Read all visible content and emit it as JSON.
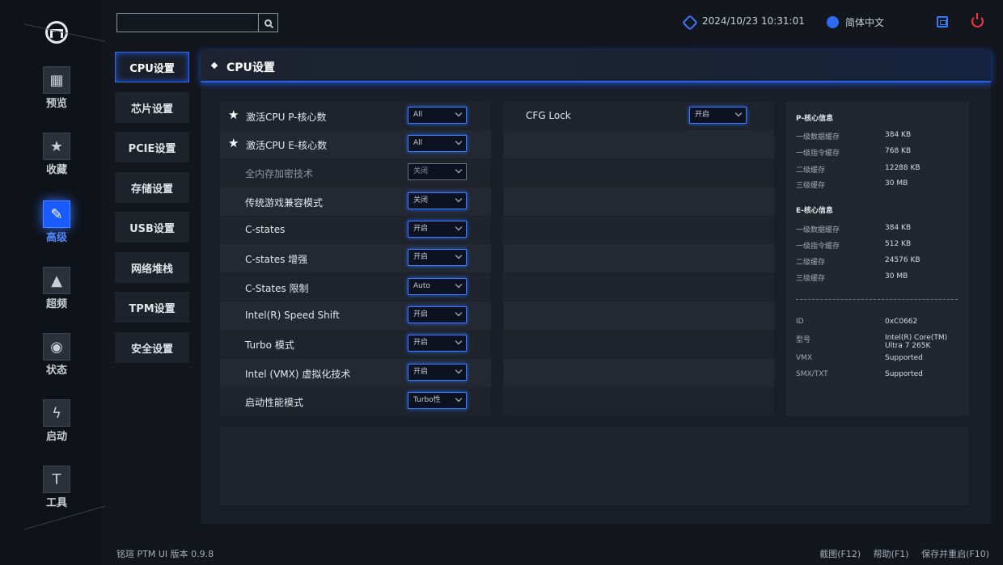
{
  "nav": [
    {
      "label": "预览",
      "icon": "overview-icon"
    },
    {
      "label": "收藏",
      "icon": "star-icon"
    },
    {
      "label": "高级",
      "icon": "wrench-icon",
      "active": true
    },
    {
      "label": "超频",
      "icon": "rocket-icon"
    },
    {
      "label": "状态",
      "icon": "eye-icon"
    },
    {
      "label": "启动",
      "icon": "ssd-icon"
    },
    {
      "label": "工具",
      "icon": "tool-icon"
    }
  ],
  "topbar": {
    "datetime": "2024/10/23 10:31:01",
    "language": "简体中文"
  },
  "subtabs": [
    "CPU设置",
    "芯片设置",
    "PCIE设置",
    "存储设置",
    "USB设置",
    "网络堆栈",
    "TPM设置",
    "安全设置"
  ],
  "panel": {
    "title": "CPU设置"
  },
  "settings": [
    {
      "label": "激活CPU P-核心数",
      "value": "All",
      "starred": true
    },
    {
      "label": "激活CPU E-核心数",
      "value": "All",
      "starred": true
    },
    {
      "label": "全内存加密技术",
      "value": "关闭",
      "disabled": true
    },
    {
      "label": "传统游戏兼容模式",
      "value": "关闭"
    },
    {
      "label": "C-states",
      "value": "开启"
    },
    {
      "label": "C-states 增强",
      "value": "开启"
    },
    {
      "label": "C-States 限制",
      "value": "Auto"
    },
    {
      "label": "Intel(R) Speed Shift",
      "value": "开启"
    },
    {
      "label": "Turbo 模式",
      "value": "开启"
    },
    {
      "label": "Intel (VMX) 虚拟化技术",
      "value": "开启"
    },
    {
      "label": "启动性能模式",
      "value": "Turbo性"
    }
  ],
  "settings2": [
    {
      "label": "CFG Lock",
      "value": "开启"
    }
  ],
  "info": {
    "p_header": "P-核心信息",
    "p_rows": [
      {
        "k": "一级数据缓存",
        "v": "384 KB"
      },
      {
        "k": "一级指令缓存",
        "v": "768 KB"
      },
      {
        "k": "二级缓存",
        "v": "12288 KB"
      },
      {
        "k": "三级缓存",
        "v": "30 MB"
      }
    ],
    "e_header": "E-核心信息",
    "e_rows": [
      {
        "k": "一级数据缓存",
        "v": "384 KB"
      },
      {
        "k": "一级指令缓存",
        "v": "512 KB"
      },
      {
        "k": "二级缓存",
        "v": "24576 KB"
      },
      {
        "k": "三级缓存",
        "v": "30 MB"
      }
    ],
    "cpu_rows": [
      {
        "k": "ID",
        "v": "0xC0662"
      },
      {
        "k": "型号",
        "v": "Intel(R) Core(TM) Ultra 7 265K"
      },
      {
        "k": "VMX",
        "v": "Supported"
      },
      {
        "k": "SMX/TXT",
        "v": "Supported"
      }
    ]
  },
  "footer": {
    "version": "铭瑄 PTM UI 版本 0.9.8",
    "screenshot": "截图(F12)",
    "help": "帮助(F1)",
    "save_restart": "保存并重启(F10)"
  },
  "colors": {
    "accent": "#2f6df5",
    "power": "#ff3340",
    "background": "#13161d"
  }
}
